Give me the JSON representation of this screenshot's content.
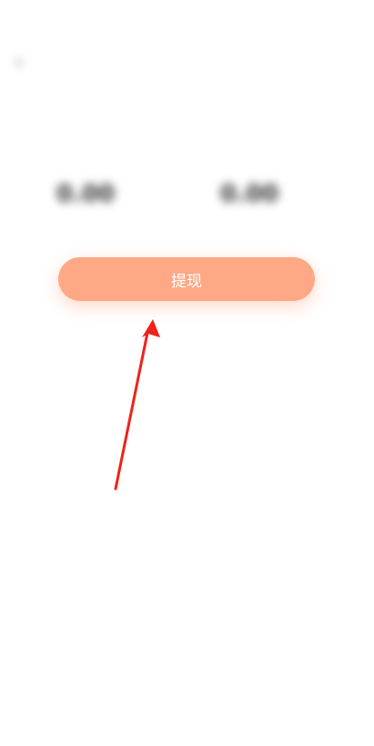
{
  "status_bar": {
    "time": "",
    "icons": ""
  },
  "header": {
    "back_icon": "back-arrow-icon",
    "title": ""
  },
  "notice": {
    "text": ""
  },
  "balances": [
    {
      "label": "",
      "value": "0.00"
    },
    {
      "label": "",
      "value": "0.00"
    }
  ],
  "withdraw_button": {
    "label": "提现",
    "color": "#fea885"
  },
  "annotation": {
    "arrow_color": "#f0221a"
  }
}
